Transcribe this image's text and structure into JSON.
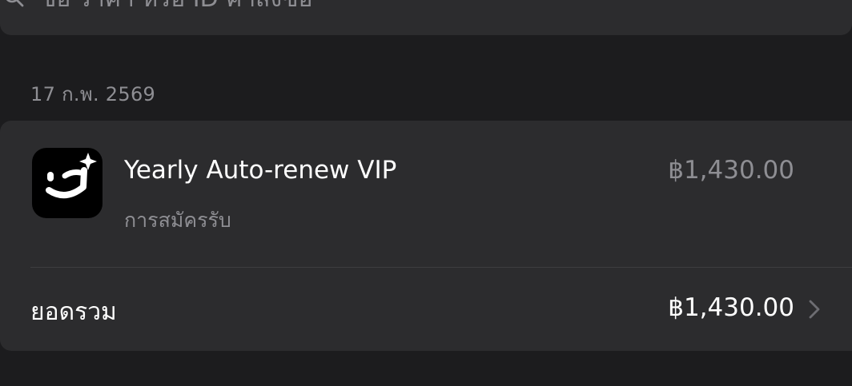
{
  "search": {
    "placeholder": "ชื่อ ราคา หรือ ID คำสั่งซื้อ"
  },
  "section": {
    "date": "17 ก.พ. 2569"
  },
  "receipt": {
    "item": {
      "icon": "app-logo-wink-icon",
      "title": "Yearly Auto-renew VIP",
      "subtitle": "การสมัครรับ",
      "price": "฿1,430.00"
    },
    "total": {
      "label": "ยอดรวม",
      "amount": "฿1,430.00"
    }
  },
  "colors": {
    "background": "#1c1c1e",
    "card": "#2c2c2e",
    "secondary_text": "#8e8e93",
    "primary_text": "#ffffff"
  }
}
